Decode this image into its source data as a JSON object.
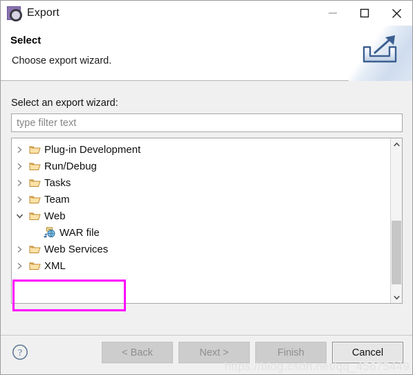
{
  "window": {
    "title": "Export",
    "title_icon": "export-wizard-gear-icon",
    "controls": {
      "minimize": "minimize-icon",
      "maximize": "maximize-icon",
      "close": "close-icon"
    }
  },
  "header": {
    "title": "Select",
    "subtitle": "Choose export wizard.",
    "banner_icon": "export-tray-arrow-icon"
  },
  "main": {
    "field_label": "Select an export wizard:",
    "filter": {
      "value": "",
      "placeholder": "type filter text"
    },
    "tree": [
      {
        "label": "Plug-in Development",
        "icon": "folder-icon",
        "state": "collapsed",
        "level": 0
      },
      {
        "label": "Run/Debug",
        "icon": "folder-icon",
        "state": "collapsed",
        "level": 0
      },
      {
        "label": "Tasks",
        "icon": "folder-icon",
        "state": "collapsed",
        "level": 0
      },
      {
        "label": "Team",
        "icon": "folder-icon",
        "state": "collapsed",
        "level": 0
      },
      {
        "label": "Web",
        "icon": "folder-icon",
        "state": "expanded",
        "level": 0
      },
      {
        "label": "WAR file",
        "icon": "war-file-icon",
        "state": "leaf",
        "level": 1
      },
      {
        "label": "Web Services",
        "icon": "folder-icon",
        "state": "collapsed",
        "level": 0
      },
      {
        "label": "XML",
        "icon": "folder-icon",
        "state": "collapsed",
        "level": 0
      }
    ],
    "highlight_color": "#ff00ff",
    "scrollbar": {
      "up_arrow": "chevron-up-icon",
      "down_arrow": "chevron-down-icon"
    }
  },
  "footer": {
    "help_icon": "help-question-icon",
    "buttons": [
      {
        "label": "< Back",
        "enabled": false
      },
      {
        "label": "Next >",
        "enabled": false
      },
      {
        "label": "Finish",
        "enabled": false
      },
      {
        "label": "Cancel",
        "enabled": true
      }
    ]
  },
  "watermark": "https://blog.csdn.net/qq_45675449"
}
